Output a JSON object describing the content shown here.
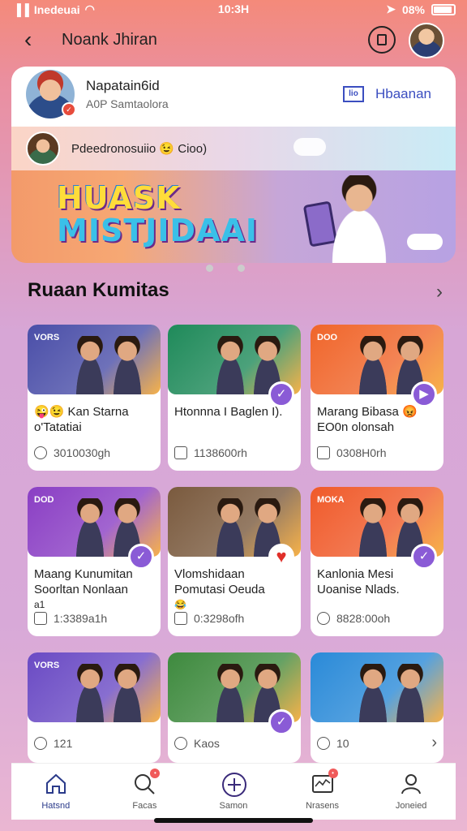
{
  "status_bar": {
    "carrier": "Inedeuai",
    "time": "10:3H",
    "battery": "08%"
  },
  "header": {
    "title": "Noank Jhiran"
  },
  "profile": {
    "name": "Napatain6id",
    "subtitle": "A0P Samtaolora",
    "action_logo": "lio",
    "action_label": "Hbaanan"
  },
  "story": {
    "text": "Pdeedronosuiio 😉 Cioo)"
  },
  "banner": {
    "title_line1": "HUASK",
    "title_line2": "MISTJIDAAI"
  },
  "section": {
    "title": "Ruaan Kumitas",
    "more_icon": "chevron-right-icon"
  },
  "cards": [
    {
      "thumb_label": "VORS",
      "thumb_color": "#4a4ea8",
      "title": "😜😉 Kan Starna o'Tatatiai",
      "meta": "3010030gh",
      "badge": "",
      "meta_icon": "clock-icon"
    },
    {
      "thumb_label": "",
      "thumb_color": "#1f8a5a",
      "title": "Htonnna I Baglen I).",
      "meta": "1138600rh",
      "badge": "✓",
      "meta_icon": "calendar-icon"
    },
    {
      "thumb_label": "DOO",
      "thumb_color": "#f0652a",
      "title": "Marang Bibasa 😡 EO0n olonsah",
      "meta": "0308H0rh",
      "badge": "▶",
      "meta_icon": "calendar-icon"
    },
    {
      "thumb_label": "DOD",
      "thumb_color": "#8a3ec4",
      "title": "Maang Kunumitan Soorltan Nonlaan",
      "meta": "1:3389a1h",
      "badge": "✓",
      "meta_icon": "calendar-icon",
      "extra": "a1"
    },
    {
      "thumb_label": "",
      "thumb_color": "#7a5a3e",
      "title": "Vlomshidaan Pomutasi Oeuda",
      "meta": "0:3298ofh",
      "badge": "♥",
      "meta_icon": "calendar-icon",
      "extra": "😂"
    },
    {
      "thumb_label": "MOKA",
      "thumb_color": "#f05a2a",
      "title": "Kanlonia Mesi Uoanise Nlads.",
      "meta": "8828:00oh",
      "badge": "✓",
      "meta_icon": "clock-icon"
    },
    {
      "thumb_label": "VORS",
      "thumb_color": "#6a4ac4",
      "title": "",
      "meta": "121",
      "badge": "",
      "meta_icon": "emoji-icon"
    },
    {
      "thumb_label": "",
      "thumb_color": "#3e8a3e",
      "title": "",
      "meta": "Kaos",
      "badge": "✓",
      "meta_icon": "emoji-icon"
    },
    {
      "thumb_label": "",
      "thumb_color": "#2a8ad8",
      "title": "",
      "meta": "10",
      "badge": "",
      "meta_icon": "emoji-icon"
    }
  ],
  "bottom_nav": [
    {
      "label": "Hatsnd",
      "icon": "home-icon"
    },
    {
      "label": "Facas",
      "icon": "search-icon"
    },
    {
      "label": "Samon",
      "icon": "plus-circle-icon"
    },
    {
      "label": "Nrasens",
      "icon": "inbox-icon"
    },
    {
      "label": "Joneied",
      "icon": "profile-icon"
    }
  ]
}
